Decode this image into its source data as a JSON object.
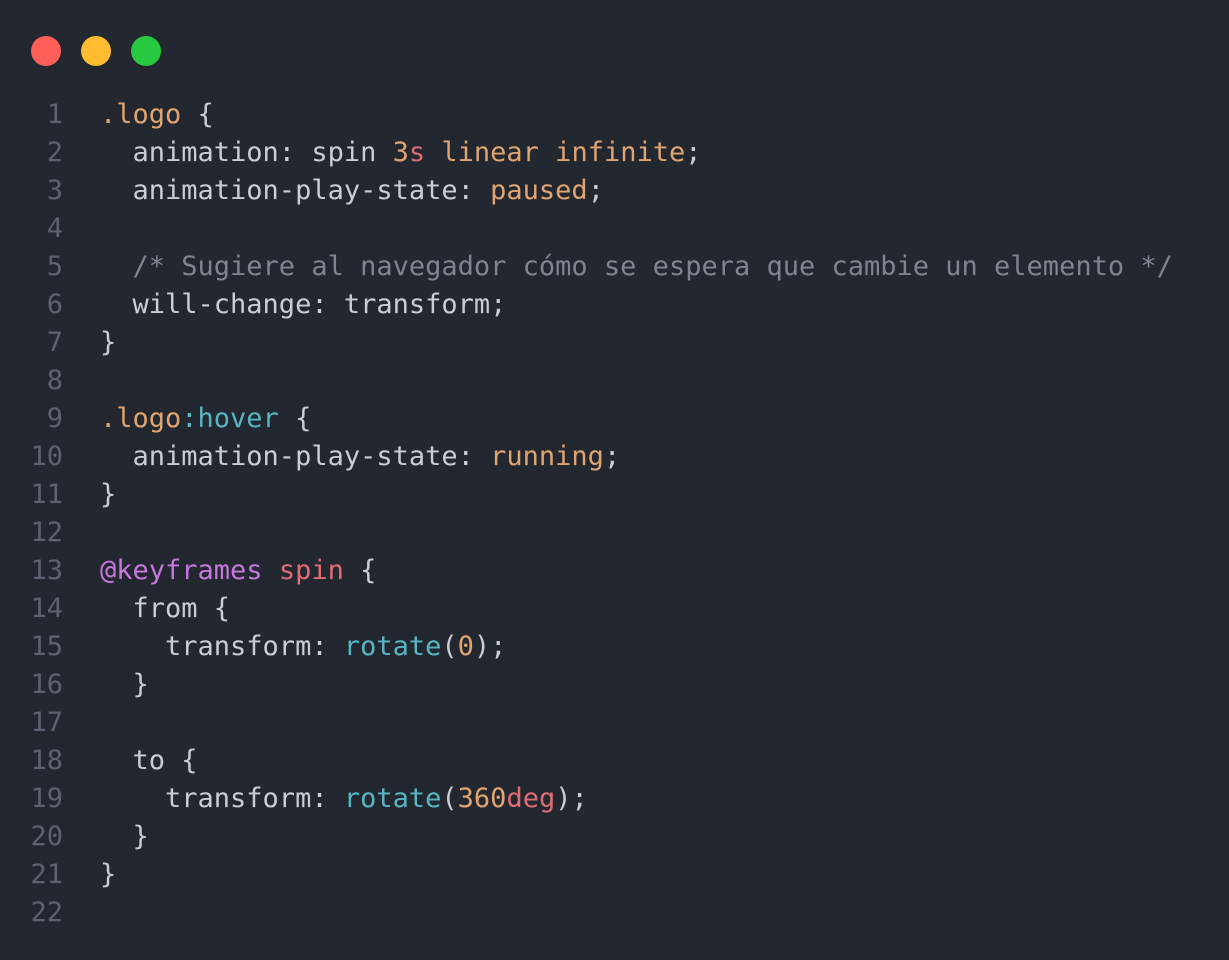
{
  "window": {
    "controls": [
      {
        "name": "close-button",
        "color": "#ff5f57"
      },
      {
        "name": "minimize-button",
        "color": "#febc2e"
      },
      {
        "name": "maximize-button",
        "color": "#28c840"
      }
    ]
  },
  "editor": {
    "language": "css",
    "colors": {
      "background": "#232730",
      "line_number": "#5c6270",
      "plain": "#c9cdd4",
      "selector": "#e0a470",
      "pseudo": "#56b6c2",
      "keyword": "#c678dd",
      "name": "#e06c75",
      "number": "#e0a470",
      "unit": "#e06c75",
      "value": "#e0a470",
      "function": "#56b6c2",
      "comment": "#7f848e"
    },
    "lines": [
      {
        "n": "1",
        "tokens": [
          {
            "t": ".logo",
            "k": "selector"
          },
          {
            "t": " {",
            "k": "plain"
          }
        ]
      },
      {
        "n": "2",
        "tokens": [
          {
            "t": "  animation: spin ",
            "k": "plain"
          },
          {
            "t": "3",
            "k": "number"
          },
          {
            "t": "s",
            "k": "unit"
          },
          {
            "t": " linear infinite",
            "k": "value"
          },
          {
            "t": ";",
            "k": "plain"
          }
        ]
      },
      {
        "n": "3",
        "tokens": [
          {
            "t": "  animation-play-state: ",
            "k": "plain"
          },
          {
            "t": "paused",
            "k": "value"
          },
          {
            "t": ";",
            "k": "plain"
          }
        ]
      },
      {
        "n": "4",
        "tokens": []
      },
      {
        "n": "5",
        "tokens": [
          {
            "t": "  /* Sugiere al navegador cómo se espera que cambie un elemento */",
            "k": "comment"
          }
        ]
      },
      {
        "n": "6",
        "tokens": [
          {
            "t": "  will-change: transform;",
            "k": "plain"
          }
        ]
      },
      {
        "n": "7",
        "tokens": [
          {
            "t": "}",
            "k": "plain"
          }
        ]
      },
      {
        "n": "8",
        "tokens": []
      },
      {
        "n": "9",
        "tokens": [
          {
            "t": ".logo",
            "k": "selector"
          },
          {
            "t": ":hover",
            "k": "pseudo"
          },
          {
            "t": " {",
            "k": "plain"
          }
        ]
      },
      {
        "n": "10",
        "tokens": [
          {
            "t": "  animation-play-state: ",
            "k": "plain"
          },
          {
            "t": "running",
            "k": "value"
          },
          {
            "t": ";",
            "k": "plain"
          }
        ]
      },
      {
        "n": "11",
        "tokens": [
          {
            "t": "}",
            "k": "plain"
          }
        ]
      },
      {
        "n": "12",
        "tokens": []
      },
      {
        "n": "13",
        "tokens": [
          {
            "t": "@keyframes",
            "k": "keyword"
          },
          {
            "t": " ",
            "k": "plain"
          },
          {
            "t": "spin",
            "k": "name"
          },
          {
            "t": " {",
            "k": "plain"
          }
        ]
      },
      {
        "n": "14",
        "tokens": [
          {
            "t": "  from {",
            "k": "plain"
          }
        ]
      },
      {
        "n": "15",
        "tokens": [
          {
            "t": "    transform: ",
            "k": "plain"
          },
          {
            "t": "rotate",
            "k": "func"
          },
          {
            "t": "(",
            "k": "plain"
          },
          {
            "t": "0",
            "k": "number"
          },
          {
            "t": ");",
            "k": "plain"
          }
        ]
      },
      {
        "n": "16",
        "tokens": [
          {
            "t": "  }",
            "k": "plain"
          }
        ]
      },
      {
        "n": "17",
        "tokens": []
      },
      {
        "n": "18",
        "tokens": [
          {
            "t": "  to {",
            "k": "plain"
          }
        ]
      },
      {
        "n": "19",
        "tokens": [
          {
            "t": "    transform: ",
            "k": "plain"
          },
          {
            "t": "rotate",
            "k": "func"
          },
          {
            "t": "(",
            "k": "plain"
          },
          {
            "t": "360",
            "k": "number"
          },
          {
            "t": "deg",
            "k": "unit"
          },
          {
            "t": ");",
            "k": "plain"
          }
        ]
      },
      {
        "n": "20",
        "tokens": [
          {
            "t": "  }",
            "k": "plain"
          }
        ]
      },
      {
        "n": "21",
        "tokens": [
          {
            "t": "}",
            "k": "plain"
          }
        ]
      },
      {
        "n": "22",
        "tokens": []
      }
    ]
  }
}
